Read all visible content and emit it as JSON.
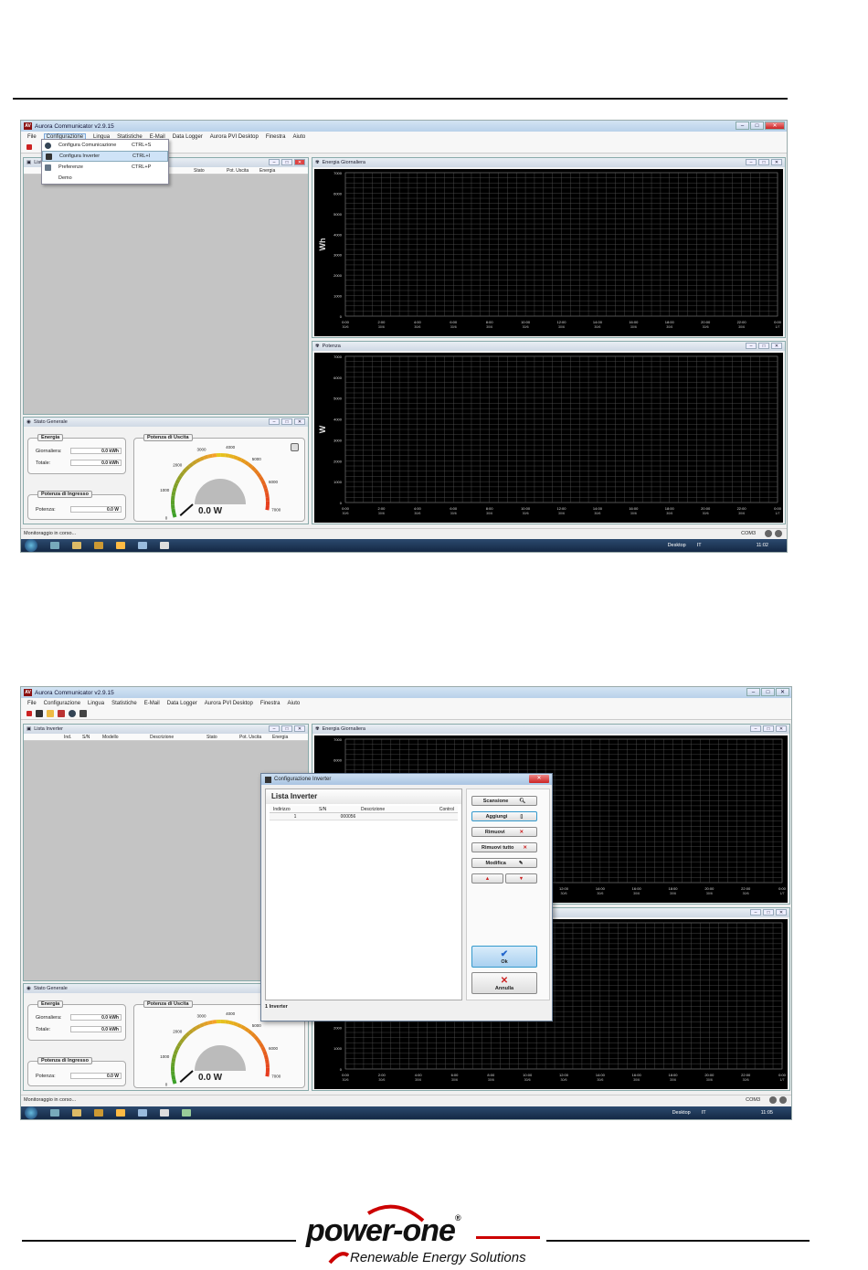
{
  "app": {
    "title": "Aurora Communicator v2.9.15",
    "menu": [
      "File",
      "Configurazione",
      "Lingua",
      "Statistiche",
      "E-Mail",
      "Data Logger",
      "Aurora PVI Desktop",
      "Finestra",
      "Aiuto"
    ]
  },
  "dropdown": {
    "items": [
      {
        "label": "Configura Comunicazione",
        "shortcut": "CTRL+S"
      },
      {
        "label": "Configura Inverter",
        "shortcut": "CTRL+I"
      },
      {
        "label": "Preferenze",
        "shortcut": "CTRL+P"
      },
      {
        "label": "Demo",
        "shortcut": ""
      }
    ]
  },
  "lista_inverter": {
    "title": "Lista Inverter",
    "columns": [
      "Ind.",
      "S/N",
      "Modello",
      "Descrizione",
      "Stato",
      "Pot. Uscita",
      "Energia"
    ]
  },
  "stato_generale": {
    "title": "Stato Generale",
    "energia_title": "Energia",
    "giornaliera_label": "Giornaliera:",
    "giornaliera_value": "0.0 kWh",
    "totale_label": "Totale:",
    "totale_value": "0.0 kWh",
    "potenza_ingresso_title": "Potenza di Ingresso",
    "potenza_label": "Potenza:",
    "potenza_value": "0.0 W",
    "potenza_uscita_title": "Potenza di Uscita",
    "gauge_ticks": [
      "0",
      "1000",
      "2000",
      "3000",
      "4000",
      "5000",
      "6000",
      "7000"
    ],
    "gauge_value": "0.0 W"
  },
  "energia_chart": {
    "title": "Energia Giornaliera",
    "ylabel": "Wh",
    "yticks": [
      "7000",
      "6000",
      "5000",
      "4000",
      "3000",
      "2000",
      "1000",
      "0"
    ],
    "xticks": [
      "0:00",
      "2:00",
      "4:00",
      "6:00",
      "8:00",
      "10:00",
      "12:00",
      "14:00",
      "16:00",
      "18:00",
      "20:00",
      "22:00",
      "0:00"
    ],
    "xdates": [
      "30/6",
      "30/6",
      "30/6",
      "30/6",
      "30/6",
      "30/6",
      "30/6",
      "30/6",
      "30/6",
      "30/6",
      "30/6",
      "30/6",
      "1/7"
    ]
  },
  "potenza_chart": {
    "title": "Potenza",
    "ylabel": "W",
    "yticks": [
      "7000",
      "6000",
      "5000",
      "4000",
      "3000",
      "2000",
      "1000",
      "0"
    ]
  },
  "status": {
    "text": "Monitoraggio in corso...",
    "port": "COM3"
  },
  "taskbar": {
    "desktop": "Desktop",
    "lang": "IT",
    "time1": "11:02",
    "time2": "11:05"
  },
  "dialog": {
    "title": "Configurazione Inverter",
    "heading": "Lista Inverter",
    "columns": [
      "Indirizzo",
      "S/N",
      "Descrizione",
      "Control"
    ],
    "row": {
      "indirizzo": "1",
      "sn": "000056"
    },
    "buttons": {
      "scansione": "Scansione",
      "aggiungi": "Aggiungi",
      "rimuovi": "Rimuovi",
      "rimuovi_tutto": "Rimuovi tutto",
      "modifica": "Modifica",
      "ok": "Ok",
      "annulla": "Annulla"
    },
    "footer": "1 Inverter"
  },
  "logo": {
    "brand": "power-one",
    "reg": "®",
    "tagline": "Renewable Energy Solutions"
  }
}
